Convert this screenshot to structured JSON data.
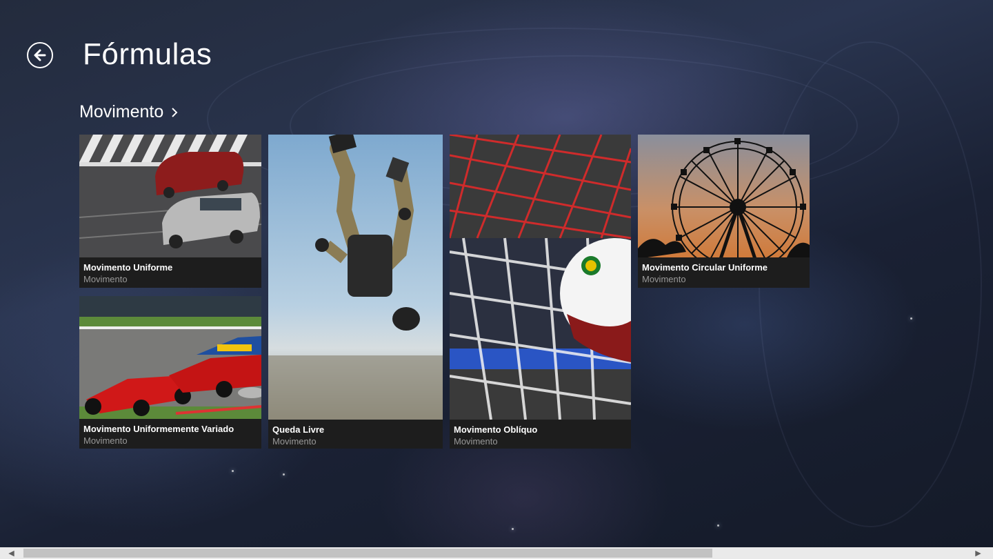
{
  "header": {
    "title": "Fórmulas"
  },
  "group": {
    "title": "Movimento",
    "chevron_icon": "chevron-right-icon"
  },
  "tiles": [
    {
      "title": "Movimento Uniforme",
      "subtitle": "Movimento",
      "image": "cars-on-road"
    },
    {
      "title": "Movimento Uniformemente Variado",
      "subtitle": "Movimento",
      "image": "formula-one-race"
    },
    {
      "title": "Queda Livre",
      "subtitle": "Movimento",
      "image": "skydiver"
    },
    {
      "title": "Movimento Oblíquo",
      "subtitle": "Movimento",
      "image": "soccer-ball-net"
    },
    {
      "title": "Movimento Circular Uniforme",
      "subtitle": "Movimento",
      "image": "ferris-wheel-sunset"
    }
  ],
  "scrollbar": {
    "position": 0.0,
    "thumb_fraction": 0.69
  }
}
